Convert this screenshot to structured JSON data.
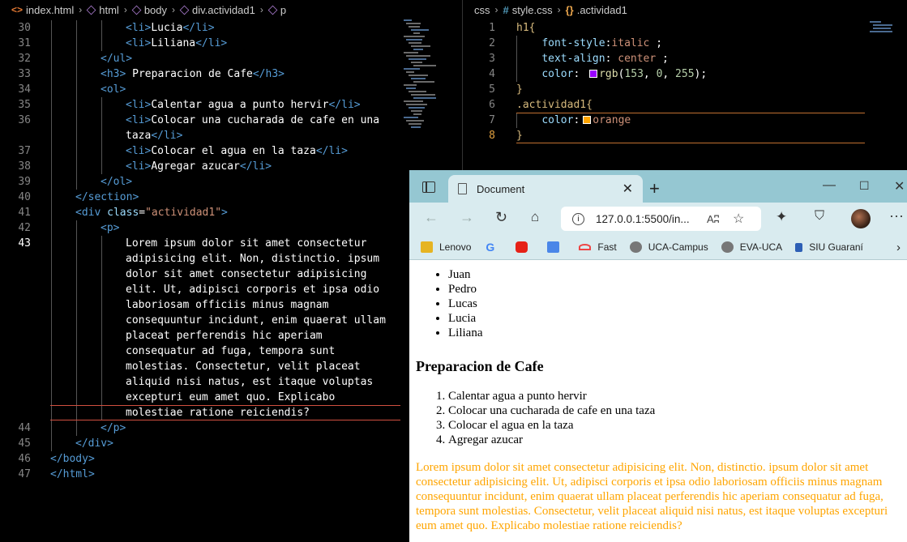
{
  "left_editor": {
    "breadcrumb": [
      "index.html",
      "html",
      "body",
      "div.actividad1",
      "p"
    ],
    "lines": [
      {
        "n": "30",
        "parts": [
          [
            "t",
            "<li>"
          ],
          [
            "x",
            "Lucia"
          ],
          [
            "t",
            "</li>"
          ]
        ],
        "indent": 3
      },
      {
        "n": "31",
        "parts": [
          [
            "t",
            "<li>"
          ],
          [
            "x",
            "Liliana"
          ],
          [
            "t",
            "</li>"
          ]
        ],
        "indent": 3
      },
      {
        "n": "32",
        "parts": [
          [
            "t",
            "</ul>"
          ]
        ],
        "indent": 2
      },
      {
        "n": "33",
        "parts": [
          [
            "t",
            "<h3>"
          ],
          [
            "x",
            " Preparacion de Cafe"
          ],
          [
            "t",
            "</h3>"
          ]
        ],
        "indent": 2
      },
      {
        "n": "34",
        "parts": [
          [
            "t",
            "<ol>"
          ]
        ],
        "indent": 2
      },
      {
        "n": "35",
        "parts": [
          [
            "t",
            "<li>"
          ],
          [
            "x",
            "Calentar agua a punto hervir"
          ],
          [
            "t",
            "</li>"
          ]
        ],
        "indent": 3
      },
      {
        "n": "36",
        "parts": [
          [
            "t",
            "<li>"
          ],
          [
            "x",
            "Colocar una cucharada de cafe en una"
          ]
        ],
        "indent": 3
      },
      {
        "n": "",
        "parts": [
          [
            "x",
            "taza"
          ],
          [
            "t",
            "</li>"
          ]
        ],
        "indent": 3
      },
      {
        "n": "37",
        "parts": [
          [
            "t",
            "<li>"
          ],
          [
            "x",
            "Colocar el agua en la taza"
          ],
          [
            "t",
            "</li>"
          ]
        ],
        "indent": 3
      },
      {
        "n": "38",
        "parts": [
          [
            "t",
            "<li>"
          ],
          [
            "x",
            "Agregar azucar"
          ],
          [
            "t",
            "</li>"
          ]
        ],
        "indent": 3
      },
      {
        "n": "39",
        "parts": [
          [
            "t",
            "</ol>"
          ]
        ],
        "indent": 2
      },
      {
        "n": "40",
        "parts": [
          [
            "t",
            "</section>"
          ]
        ],
        "indent": 1
      },
      {
        "n": "41",
        "parts": [
          [
            "t",
            "<div "
          ],
          [
            "a",
            "class"
          ],
          [
            "x",
            "="
          ],
          [
            "s",
            "\"actividad1\""
          ],
          [
            "t",
            ">"
          ]
        ],
        "indent": 1
      },
      {
        "n": "42",
        "parts": [
          [
            "t",
            "<p>"
          ]
        ],
        "indent": 2
      },
      {
        "n": "43",
        "parts": [
          [
            "x",
            "Lorem ipsum dolor sit amet consectetur"
          ]
        ],
        "indent": 3
      },
      {
        "n": "",
        "parts": [
          [
            "x",
            "adipisicing elit. Non, distinctio. ipsum"
          ]
        ],
        "indent": 3
      },
      {
        "n": "",
        "parts": [
          [
            "x",
            "dolor sit amet consectetur adipisicing"
          ]
        ],
        "indent": 3
      },
      {
        "n": "",
        "parts": [
          [
            "x",
            "elit. Ut, adipisci corporis et ipsa odio"
          ]
        ],
        "indent": 3
      },
      {
        "n": "",
        "parts": [
          [
            "x",
            "laboriosam officiis minus magnam"
          ]
        ],
        "indent": 3
      },
      {
        "n": "",
        "parts": [
          [
            "x",
            "consequuntur incidunt, enim quaerat ullam"
          ]
        ],
        "indent": 3
      },
      {
        "n": "",
        "parts": [
          [
            "x",
            "placeat perferendis hic aperiam"
          ]
        ],
        "indent": 3
      },
      {
        "n": "",
        "parts": [
          [
            "x",
            "consequatur ad fuga, tempora sunt"
          ]
        ],
        "indent": 3
      },
      {
        "n": "",
        "parts": [
          [
            "x",
            "molestias. Consectetur, velit placeat"
          ]
        ],
        "indent": 3
      },
      {
        "n": "",
        "parts": [
          [
            "x",
            "aliquid nisi natus, est itaque voluptas"
          ]
        ],
        "indent": 3
      },
      {
        "n": "",
        "parts": [
          [
            "x",
            "excepturi eum amet quo. Explicabo"
          ]
        ],
        "indent": 3
      },
      {
        "n": "",
        "parts": [
          [
            "x",
            "molestiae ratione reiciendis?"
          ]
        ],
        "indent": 3
      },
      {
        "n": "44",
        "parts": [
          [
            "t",
            "</p>"
          ]
        ],
        "indent": 2
      },
      {
        "n": "45",
        "parts": [
          [
            "t",
            "</div>"
          ]
        ],
        "indent": 1
      },
      {
        "n": "46",
        "parts": [
          [
            "t",
            "</body>"
          ]
        ],
        "indent": 0
      },
      {
        "n": "47",
        "parts": [
          [
            "t",
            "</html>"
          ]
        ],
        "indent": 0
      }
    ]
  },
  "right_editor": {
    "breadcrumb": [
      "css",
      "style.css",
      ".actividad1"
    ],
    "lines": [
      {
        "n": "1",
        "parts": [
          [
            "sel",
            "h1{"
          ]
        ]
      },
      {
        "n": "2",
        "parts": [
          [
            "x",
            "    "
          ],
          [
            "prop",
            "font-style"
          ],
          [
            "x",
            ":"
          ],
          [
            "val",
            "italic"
          ],
          [
            "x",
            " ;"
          ]
        ]
      },
      {
        "n": "3",
        "parts": [
          [
            "x",
            "    "
          ],
          [
            "prop",
            "text-align"
          ],
          [
            "x",
            ": "
          ],
          [
            "val",
            "center"
          ],
          [
            "x",
            " ;"
          ]
        ]
      },
      {
        "n": "4",
        "parts": [
          [
            "x",
            "    "
          ],
          [
            "prop",
            "color"
          ],
          [
            "x",
            ": "
          ],
          [
            "swatch",
            "#9900ff"
          ],
          [
            "fn",
            "rgb"
          ],
          [
            "x",
            "("
          ],
          [
            "num",
            "153"
          ],
          [
            "x",
            ", "
          ],
          [
            "num",
            "0"
          ],
          [
            "x",
            ", "
          ],
          [
            "num",
            "255"
          ],
          [
            "x",
            ");"
          ]
        ]
      },
      {
        "n": "5",
        "parts": [
          [
            "sel",
            "}"
          ]
        ]
      },
      {
        "n": "6",
        "parts": [
          [
            "sel",
            ".actividad1{"
          ]
        ]
      },
      {
        "n": "7",
        "parts": [
          [
            "x",
            "    "
          ],
          [
            "prop",
            "color"
          ],
          [
            "x",
            ":"
          ],
          [
            "swatch",
            "#ffa500"
          ],
          [
            "val",
            "orange"
          ]
        ]
      },
      {
        "n": "8",
        "parts": [
          [
            "sel",
            "}"
          ]
        ]
      }
    ]
  },
  "browser": {
    "tab_title": "Document",
    "tab_close": "✕",
    "new_tab": "+",
    "url": "127.0.0.1:5500/in...",
    "read_aloud": "Aʭ",
    "bookmarks": [
      "Lenovo",
      "",
      "",
      "",
      "Fast",
      "UCA-Campus",
      "EVA-UCA",
      "SIU Guaraní"
    ],
    "page": {
      "ul_items": [
        "Juan",
        "Pedro",
        "Lucas",
        "Lucia",
        "Liliana"
      ],
      "heading": "Preparacion de Cafe",
      "ol_items": [
        "Calentar agua a punto hervir",
        "Colocar una cucharada de cafe en una taza",
        "Colocar el agua en la taza",
        "Agregar azucar"
      ],
      "paragraph": "Lorem ipsum dolor sit amet consectetur adipisicing elit. Non, distinctio. ipsum dolor sit amet consectetur adipisicing elit. Ut, adipisci corporis et ipsa odio laboriosam officiis minus magnam consequuntur incidunt, enim quaerat ullam placeat perferendis hic aperiam consequatur ad fuga, tempora sunt molestias. Consectetur, velit placeat aliquid nisi natus, est itaque voluptas excepturi eum amet quo. Explicabo molestiae ratione reiciendis?"
    }
  },
  "colors": {
    "h1_color": "#9900ff",
    "actividad_color": "#ffa500",
    "tabbar": "#95c7d2",
    "toolbar": "#d9ebef"
  }
}
